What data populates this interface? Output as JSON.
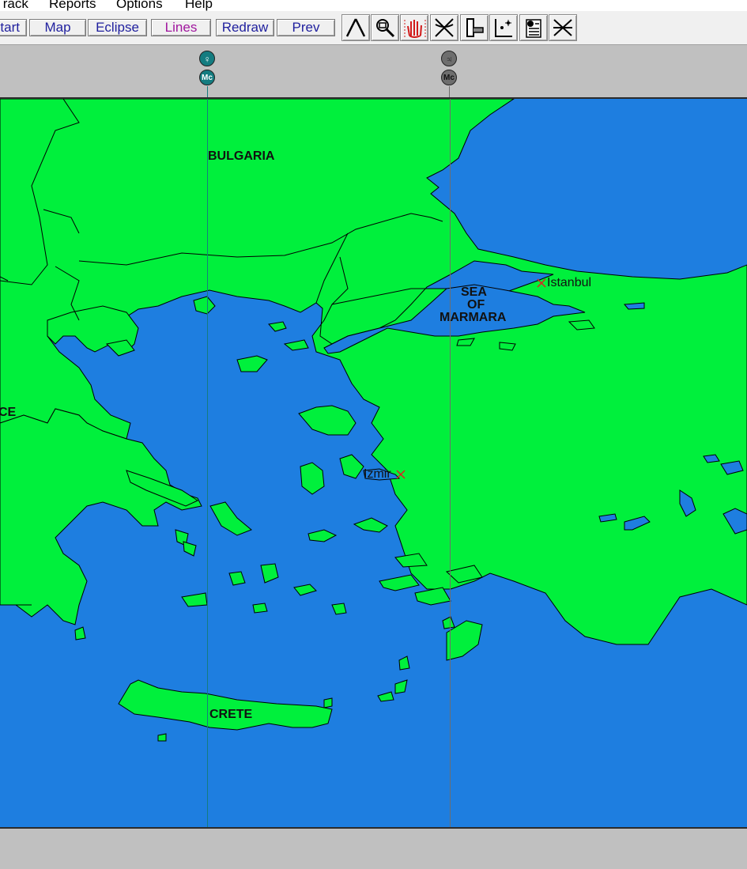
{
  "menu": {
    "items": [
      {
        "label": "Track"
      },
      {
        "label": "Reports"
      },
      {
        "label": "Options"
      },
      {
        "label": "Help"
      }
    ]
  },
  "toolbar": {
    "buttons": [
      {
        "label": "Start"
      },
      {
        "label": "Map"
      },
      {
        "label": "Eclipse"
      },
      {
        "label": "Lines"
      },
      {
        "label": "Redraw"
      },
      {
        "label": "Prev"
      }
    ],
    "tools": [
      {
        "icon": "line-tool-icon"
      },
      {
        "icon": "zoom-tool-icon"
      },
      {
        "icon": "hand-pan-icon"
      },
      {
        "icon": "crossing-lines-icon"
      },
      {
        "icon": "door-exit-icon"
      },
      {
        "icon": "star-point-icon"
      },
      {
        "icon": "info-tool-icon"
      },
      {
        "icon": "parans-tool-icon"
      }
    ]
  },
  "planet_lines": [
    {
      "planet": "♀",
      "angle": "Mc",
      "color": "#147c80"
    },
    {
      "planet": "♃",
      "angle": "Mc",
      "color": "#6e6e6e"
    }
  ],
  "map": {
    "land_color": "#00f03c",
    "sea_color": "#1e7ee0",
    "labels": {
      "bulgaria": "BULGARIA",
      "greece_partial": "CE",
      "sea_line1": "SEA",
      "sea_line2": "OF",
      "sea_line3": "MARMARA",
      "crete": "CRETE"
    },
    "cities": {
      "istanbul": "Istanbul",
      "izmir": "Izmir"
    }
  }
}
